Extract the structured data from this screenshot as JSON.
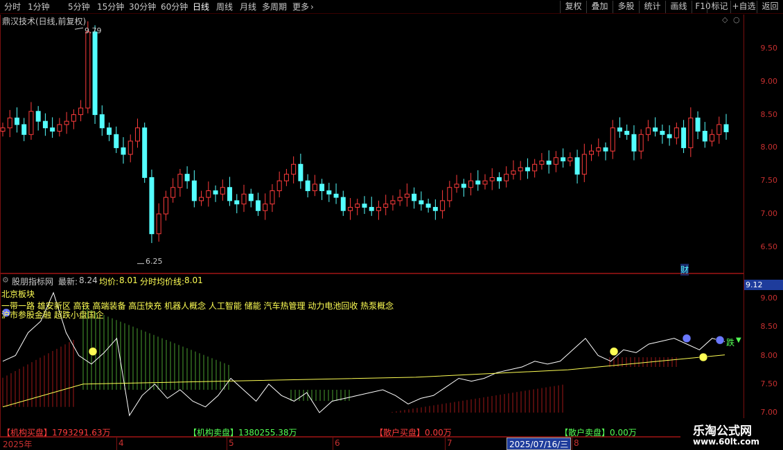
{
  "toolbar": {
    "periods": [
      "分时",
      "1分钟",
      "5分钟",
      "15分钟",
      "30分钟",
      "60分钟",
      "日线",
      "周线",
      "月线",
      "多周期",
      "更多"
    ],
    "active_index": 6,
    "more_arrow": "›",
    "right_buttons": [
      "复权",
      "叠加",
      "多股",
      "统计",
      "画线",
      "F10",
      "标记",
      "+自选",
      "返回"
    ]
  },
  "main": {
    "title": "鼎汉技术(日线,前复权)",
    "high_label": "9.79",
    "low_label": "6.25",
    "marker_cai": "财",
    "y_ticks": [
      "9.50",
      "9.00",
      "8.50",
      "8.00",
      "7.50",
      "7.00",
      "6.50"
    ],
    "y_values": [
      9.5,
      9.0,
      8.5,
      8.0,
      7.5,
      7.0,
      6.5
    ]
  },
  "indicator": {
    "name": "股朋指标网",
    "latest_label": "最新:",
    "latest_value": "8.24",
    "avg_label": "均价:",
    "avg_value": "8.01",
    "tavg_label": "分时均价线:",
    "tavg_value": "8.01",
    "sector": "北京板块",
    "concepts_line1": "一带一路 雄安新区 高铁 高端装备 高压快充 机器人概念 人工智能 储能 汽车热管理 动力电池回收 热泵概念",
    "concepts_line2": "沪市参股金融 超跌小盘国企",
    "current_price_tag": "9.12",
    "y_ticks": [
      "9.00",
      "8.50",
      "8.00",
      "7.50",
      "7.00"
    ],
    "y_values": [
      9.0,
      8.5,
      8.0,
      7.5,
      7.0
    ],
    "fall_label": "跌",
    "stat1": "【机构卖盘】1380255.38万",
    "stat2": "【散户买盘】0.00万",
    "stat3": "【散户卖盘】0.00万",
    "stat0": "【机构买盘】1793291.63万"
  },
  "dates": {
    "year": "2025年",
    "months": [
      "4",
      "5",
      "6",
      "7",
      "8"
    ],
    "cursor_date": "2025/07/16/三"
  },
  "logo": {
    "line1": "乐淘公式网",
    "line2": "www.60lt.com"
  },
  "colors": {
    "up": "#ff3c3c",
    "down": "#54ffff",
    "yellow": "#ffff54",
    "axis": "#c83030"
  },
  "chart_data": {
    "type": "candlestick",
    "price_min": 6.25,
    "price_max": 9.79,
    "close_prices": [
      8.3,
      8.45,
      8.35,
      8.2,
      8.55,
      8.4,
      8.3,
      8.25,
      8.35,
      8.4,
      8.5,
      8.6,
      9.75,
      8.5,
      8.3,
      8.2,
      8.0,
      7.9,
      8.1,
      8.3,
      7.55,
      6.7,
      7.0,
      7.25,
      7.4,
      7.6,
      7.5,
      7.2,
      7.25,
      7.35,
      7.3,
      7.4,
      7.2,
      7.15,
      7.3,
      7.2,
      7.05,
      7.15,
      7.35,
      7.5,
      7.6,
      7.75,
      7.5,
      7.35,
      7.45,
      7.35,
      7.3,
      7.25,
      7.05,
      7.1,
      7.15,
      7.1,
      7.05,
      7.1,
      7.15,
      7.2,
      7.25,
      7.3,
      7.2,
      7.15,
      7.1,
      7.05,
      7.2,
      7.4,
      7.45,
      7.4,
      7.5,
      7.45,
      7.5,
      7.55,
      7.5,
      7.6,
      7.65,
      7.7,
      7.65,
      7.75,
      7.8,
      7.75,
      7.85,
      7.8,
      7.85,
      7.6,
      7.9,
      7.95,
      8.0,
      7.95,
      8.3,
      8.25,
      8.2,
      7.95,
      8.2,
      8.3,
      8.25,
      8.2,
      8.15,
      8.3,
      8.0,
      8.45,
      8.25,
      8.1,
      8.2,
      8.35,
      8.24
    ],
    "indicator_line": [
      7.9,
      8.0,
      8.4,
      8.6,
      9.1,
      8.4,
      8.0,
      7.85,
      8.05,
      8.3,
      6.95,
      7.3,
      7.5,
      7.25,
      7.4,
      7.2,
      7.1,
      7.3,
      7.6,
      7.4,
      7.2,
      7.5,
      7.3,
      7.2,
      7.35,
      7.0,
      7.2,
      7.25,
      7.3,
      7.35,
      7.4,
      7.3,
      7.15,
      7.25,
      7.3,
      7.45,
      7.6,
      7.55,
      7.6,
      7.7,
      7.75,
      7.8,
      7.9,
      7.85,
      7.9,
      8.1,
      8.3,
      8.0,
      7.9,
      8.1,
      8.05,
      8.2,
      8.25,
      8.3,
      8.2,
      8.1,
      8.3,
      8.24
    ],
    "avg_line_start": 7.1,
    "avg_line_end": 8.01
  }
}
